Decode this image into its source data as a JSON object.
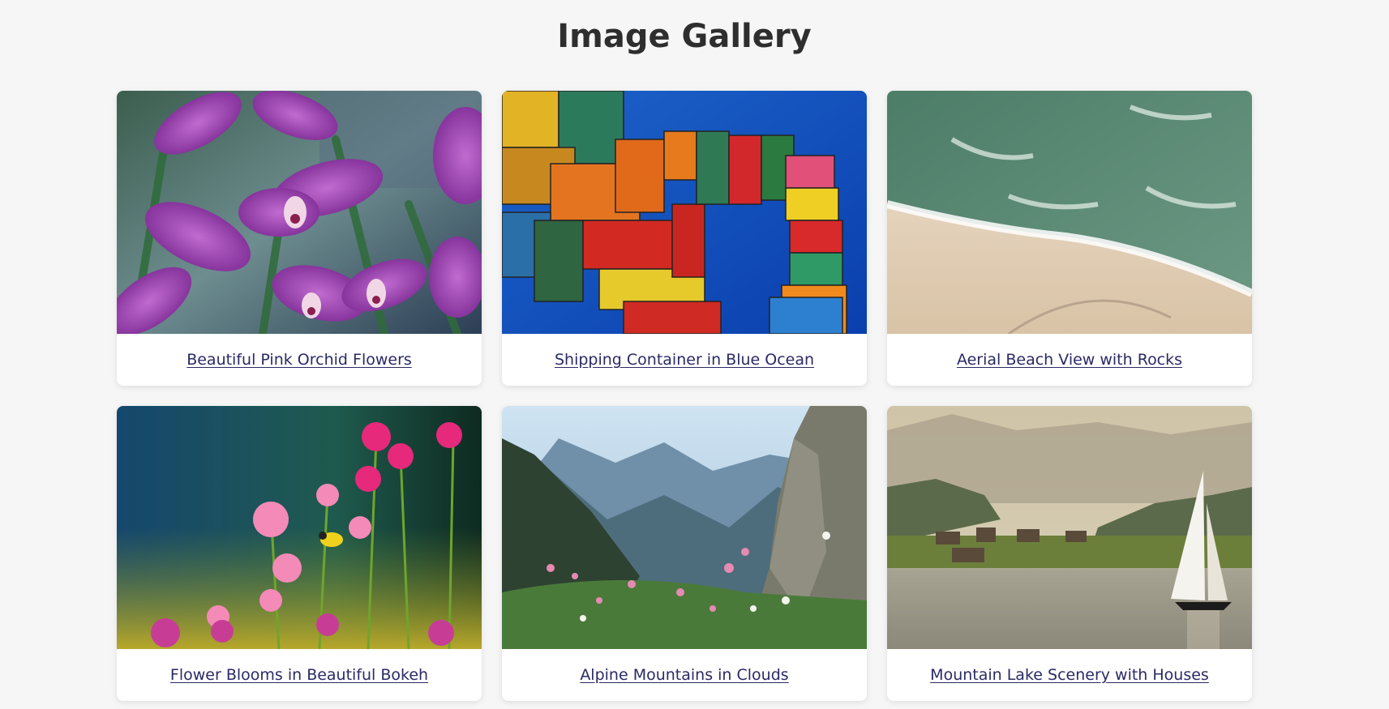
{
  "gallery": {
    "title": "Image Gallery",
    "items": [
      {
        "caption": "Beautiful Pink Orchid Flowers"
      },
      {
        "caption": "Shipping Container in Blue Ocean"
      },
      {
        "caption": "Aerial Beach View with Rocks"
      },
      {
        "caption": "Flower Blooms in Beautiful Bokeh"
      },
      {
        "caption": "Alpine Mountains in Clouds"
      },
      {
        "caption": "Mountain Lake Scenery with Houses"
      }
    ]
  }
}
